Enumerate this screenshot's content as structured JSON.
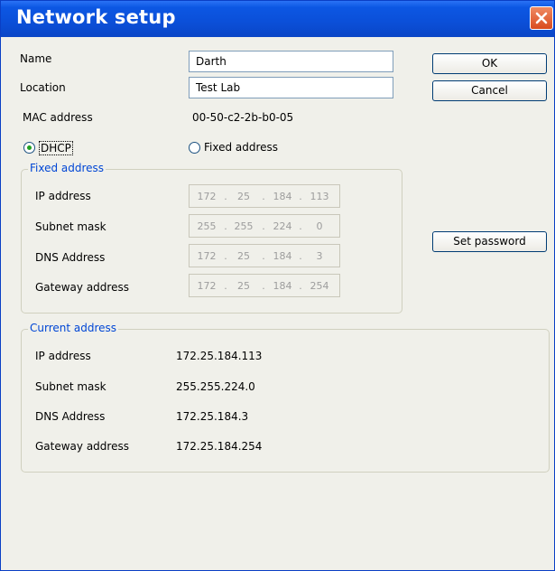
{
  "window": {
    "title": "Network setup"
  },
  "form": {
    "name_label": "Name",
    "name_value": "Darth",
    "location_label": "Location",
    "location_value": "Test Lab",
    "mac_label": "MAC address",
    "mac_value": "00-50-c2-2b-b0-05",
    "dhcp_label": "DHCP",
    "fixed_radio_label": "Fixed address",
    "dhcp_selected": true
  },
  "buttons": {
    "ok": "OK",
    "cancel": "Cancel",
    "set_password": "Set password"
  },
  "fixed_group": {
    "title": "Fixed address",
    "rows": [
      {
        "label": "IP address",
        "octets": [
          "172",
          "25",
          "184",
          "113"
        ]
      },
      {
        "label": "Subnet mask",
        "octets": [
          "255",
          "255",
          "224",
          "0"
        ]
      },
      {
        "label": "DNS Address",
        "octets": [
          "172",
          "25",
          "184",
          "3"
        ]
      },
      {
        "label": "Gateway address",
        "octets": [
          "172",
          "25",
          "184",
          "254"
        ]
      }
    ]
  },
  "current_group": {
    "title": "Current address",
    "rows": [
      {
        "label": "IP address",
        "value": "172.25.184.113"
      },
      {
        "label": "Subnet mask",
        "value": "255.255.224.0"
      },
      {
        "label": "DNS Address",
        "value": "172.25.184.3"
      },
      {
        "label": "Gateway address",
        "value": "172.25.184.254"
      }
    ]
  },
  "icons": {
    "close": "close-icon",
    "radio_selected": "radio-selected",
    "radio_empty": "radio-empty"
  },
  "colors": {
    "titlebar": "#0b4fd8",
    "close_button": "#e0582a",
    "group_legend": "#0046d5",
    "dialog_bg": "#f0f0ea"
  }
}
